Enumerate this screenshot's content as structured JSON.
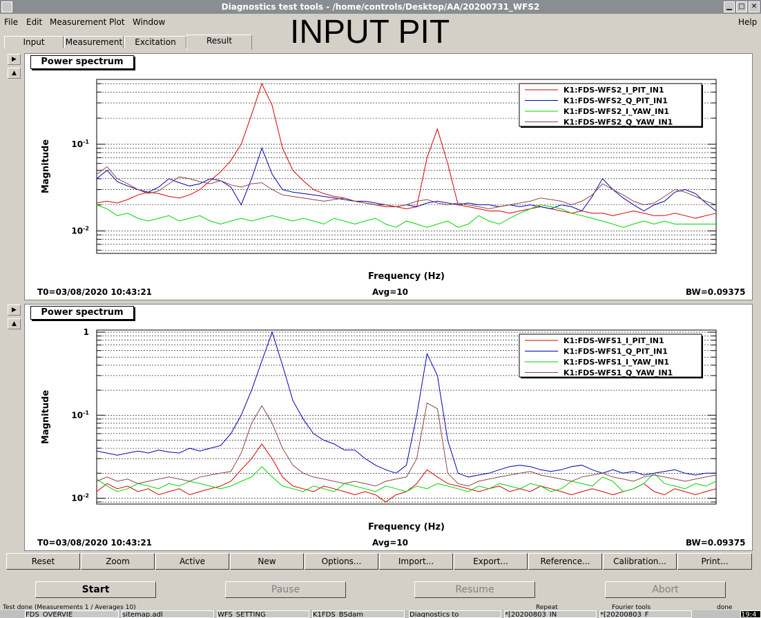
{
  "window": {
    "title": "Diagnostics test tools - /home/controls/Desktop/AA/20200731_WFS2"
  },
  "menu": [
    "File",
    "Edit",
    "Measurement",
    "Plot",
    "Window",
    "Help"
  ],
  "overlay_title": "INPUT PIT",
  "tabs": [
    "Input",
    "Measurement",
    "Excitation",
    "Result"
  ],
  "active_tab": "Result",
  "panels": [
    {
      "title": "Power spectrum",
      "ylabel": "Magnitude",
      "xlabel": "Frequency (Hz)",
      "info_t0": "T0=03/08/2020 10:43:21",
      "info_avg": "Avg=10",
      "info_bw": "BW=0.09375",
      "ytick_labels": [
        "10",
        "10"
      ],
      "ytick_exps": [
        "-1",
        "-2"
      ]
    },
    {
      "title": "Power spectrum",
      "ylabel": "Magnitude",
      "xlabel": "Frequency (Hz)",
      "info_t0": "T0=03/08/2020 10:43:21",
      "info_avg": "Avg=10",
      "info_bw": "BW=0.09375",
      "ytick_labels": [
        "1",
        "10",
        "10"
      ],
      "ytick_exps": [
        "",
        "-1",
        "-2"
      ]
    }
  ],
  "buttons": [
    "Reset",
    "Zoom",
    "Active",
    "New",
    "Options...",
    "Import...",
    "Export...",
    "Reference...",
    "Calibration...",
    "Print..."
  ],
  "controls": {
    "start": "Start",
    "pause": "Pause",
    "resume": "Resume",
    "abort": "Abort"
  },
  "status": {
    "main": "Test done (Measurements 1 / Averages 10)",
    "repeat": "Repeat",
    "fourier": "Fourier tools",
    "done": "done"
  },
  "taskbar": [
    "FDS_OVERVIE",
    "sitemap.adl",
    "WFS_SETTING",
    "K1FDS_BSdam",
    "Diagnostics to",
    "*[20200803_IN",
    "*[20200803_F",
    "19:4"
  ],
  "chart_data": [
    {
      "type": "line",
      "title": "Power spectrum",
      "xlabel": "Frequency (Hz)",
      "ylabel": "Magnitude",
      "y_scale": "log",
      "ylim": [
        0.0055,
        0.56
      ],
      "grid": true,
      "legend_position": "top-right",
      "legend": [
        "K1:FDS-WFS2_I_PIT_IN1",
        "K1:FDS-WFS2_Q_PIT_IN1",
        "K1:FDS-WFS2_I_YAW_IN1",
        "K1:FDS-WFS2_Q_YAW_IN1"
      ],
      "x": [
        0,
        1,
        2,
        3,
        4,
        5,
        6,
        7,
        8,
        9,
        10,
        11,
        12,
        13,
        14,
        15,
        16,
        17,
        18,
        19,
        20,
        21,
        22,
        23,
        24,
        25,
        26,
        27,
        28,
        29,
        30,
        31,
        32,
        33,
        34,
        35,
        36,
        37,
        38,
        39,
        40,
        41,
        42,
        43,
        44,
        45,
        46,
        47,
        48,
        49,
        50,
        51,
        52,
        53,
        54,
        55,
        56,
        57,
        58,
        59,
        60
      ],
      "series": [
        {
          "name": "K1:FDS-WFS2_I_PIT_IN1",
          "color": "#d40000",
          "values": [
            0.021,
            0.022,
            0.021,
            0.023,
            0.026,
            0.028,
            0.027,
            0.025,
            0.024,
            0.026,
            0.03,
            0.038,
            0.048,
            0.065,
            0.1,
            0.22,
            0.5,
            0.28,
            0.09,
            0.05,
            0.038,
            0.03,
            0.027,
            0.025,
            0.024,
            0.022,
            0.021,
            0.02,
            0.019,
            0.019,
            0.018,
            0.019,
            0.07,
            0.15,
            0.06,
            0.02,
            0.019,
            0.018,
            0.017,
            0.017,
            0.016,
            0.017,
            0.018,
            0.019,
            0.018,
            0.017,
            0.016,
            0.017,
            0.016,
            0.016,
            0.015,
            0.016,
            0.017,
            0.016,
            0.015,
            0.015,
            0.016,
            0.015,
            0.014,
            0.015,
            0.016
          ]
        },
        {
          "name": "K1:FDS-WFS2_Q_PIT_IN1",
          "color": "#0000b0",
          "values": [
            0.04,
            0.05,
            0.037,
            0.033,
            0.03,
            0.028,
            0.032,
            0.04,
            0.036,
            0.033,
            0.035,
            0.04,
            0.038,
            0.032,
            0.02,
            0.04,
            0.09,
            0.045,
            0.03,
            0.028,
            0.027,
            0.026,
            0.025,
            0.024,
            0.023,
            0.022,
            0.022,
            0.021,
            0.02,
            0.019,
            0.02,
            0.019,
            0.021,
            0.022,
            0.021,
            0.02,
            0.021,
            0.02,
            0.02,
            0.019,
            0.02,
            0.019,
            0.02,
            0.019,
            0.018,
            0.02,
            0.019,
            0.017,
            0.025,
            0.04,
            0.03,
            0.024,
            0.02,
            0.017,
            0.02,
            0.022,
            0.028,
            0.03,
            0.027,
            0.021,
            0.017
          ]
        },
        {
          "name": "K1:FDS-WFS2_I_YAW_IN1",
          "color": "#00d400",
          "values": [
            0.02,
            0.018,
            0.015,
            0.016,
            0.014,
            0.013,
            0.014,
            0.015,
            0.013,
            0.014,
            0.015,
            0.013,
            0.012,
            0.013,
            0.014,
            0.013,
            0.014,
            0.015,
            0.014,
            0.013,
            0.014,
            0.013,
            0.012,
            0.014,
            0.013,
            0.012,
            0.013,
            0.014,
            0.012,
            0.011,
            0.013,
            0.012,
            0.011,
            0.012,
            0.013,
            0.011,
            0.012,
            0.015,
            0.013,
            0.012,
            0.014,
            0.016,
            0.018,
            0.02,
            0.019,
            0.018,
            0.016,
            0.015,
            0.014,
            0.013,
            0.012,
            0.011,
            0.012,
            0.013,
            0.012,
            0.013,
            0.012,
            0.012,
            0.012,
            0.012,
            0.012
          ]
        },
        {
          "name": "K1:FDS-WFS2_Q_YAW_IN1",
          "color": "#8b4545",
          "values": [
            0.045,
            0.055,
            0.04,
            0.035,
            0.03,
            0.027,
            0.029,
            0.035,
            0.042,
            0.04,
            0.037,
            0.035,
            0.038,
            0.034,
            0.032,
            0.035,
            0.036,
            0.03,
            0.026,
            0.025,
            0.024,
            0.023,
            0.022,
            0.023,
            0.024,
            0.022,
            0.021,
            0.02,
            0.02,
            0.019,
            0.02,
            0.022,
            0.023,
            0.021,
            0.02,
            0.021,
            0.02,
            0.019,
            0.018,
            0.019,
            0.02,
            0.021,
            0.022,
            0.024,
            0.023,
            0.022,
            0.02,
            0.022,
            0.026,
            0.035,
            0.03,
            0.026,
            0.022,
            0.02,
            0.021,
            0.025,
            0.03,
            0.028,
            0.025,
            0.022,
            0.02
          ]
        }
      ]
    },
    {
      "type": "line",
      "title": "Power spectrum",
      "xlabel": "Frequency (Hz)",
      "ylabel": "Magnitude",
      "y_scale": "log",
      "ylim": [
        0.0085,
        1.06
      ],
      "grid": true,
      "legend_position": "top-right",
      "legend": [
        "K1:FDS-WFS1_I_PIT_IN1",
        "K1:FDS-WFS1_Q_PIT_IN1",
        "K1:FDS-WFS1_I_YAW_IN1",
        "K1:FDS-WFS1_Q_YAW_IN1"
      ],
      "x": [
        0,
        1,
        2,
        3,
        4,
        5,
        6,
        7,
        8,
        9,
        10,
        11,
        12,
        13,
        14,
        15,
        16,
        17,
        18,
        19,
        20,
        21,
        22,
        23,
        24,
        25,
        26,
        27,
        28,
        29,
        30,
        31,
        32,
        33,
        34,
        35,
        36,
        37,
        38,
        39,
        40,
        41,
        42,
        43,
        44,
        45,
        46,
        47,
        48,
        49,
        50,
        51,
        52,
        53,
        54,
        55,
        56,
        57,
        58,
        59,
        60
      ],
      "series": [
        {
          "name": "K1:FDS-WFS1_I_PIT_IN1",
          "color": "#d40000",
          "values": [
            0.012,
            0.015,
            0.013,
            0.014,
            0.012,
            0.013,
            0.011,
            0.012,
            0.013,
            0.011,
            0.012,
            0.013,
            0.014,
            0.016,
            0.022,
            0.03,
            0.045,
            0.03,
            0.018,
            0.014,
            0.013,
            0.012,
            0.014,
            0.013,
            0.012,
            0.011,
            0.012,
            0.011,
            0.009,
            0.011,
            0.012,
            0.015,
            0.022,
            0.018,
            0.015,
            0.014,
            0.013,
            0.012,
            0.013,
            0.014,
            0.012,
            0.013,
            0.012,
            0.014,
            0.013,
            0.012,
            0.011,
            0.012,
            0.013,
            0.012,
            0.011,
            0.012,
            0.013,
            0.015,
            0.012,
            0.011,
            0.013,
            0.012,
            0.011,
            0.012,
            0.013
          ]
        },
        {
          "name": "K1:FDS-WFS1_Q_PIT_IN1",
          "color": "#0000b0",
          "values": [
            0.037,
            0.035,
            0.033,
            0.035,
            0.037,
            0.035,
            0.038,
            0.036,
            0.035,
            0.04,
            0.037,
            0.04,
            0.043,
            0.06,
            0.1,
            0.2,
            0.45,
            1.0,
            0.4,
            0.15,
            0.09,
            0.06,
            0.05,
            0.045,
            0.038,
            0.038,
            0.03,
            0.025,
            0.022,
            0.02,
            0.025,
            0.1,
            0.55,
            0.3,
            0.05,
            0.02,
            0.018,
            0.019,
            0.02,
            0.022,
            0.024,
            0.025,
            0.024,
            0.022,
            0.021,
            0.022,
            0.024,
            0.025,
            0.022,
            0.02,
            0.022,
            0.02,
            0.021,
            0.019,
            0.02,
            0.021,
            0.022,
            0.02,
            0.019,
            0.02,
            0.02
          ]
        },
        {
          "name": "K1:FDS-WFS1_I_YAW_IN1",
          "color": "#00d400",
          "values": [
            0.017,
            0.014,
            0.012,
            0.013,
            0.015,
            0.014,
            0.013,
            0.015,
            0.014,
            0.016,
            0.015,
            0.014,
            0.013,
            0.014,
            0.016,
            0.018,
            0.024,
            0.018,
            0.014,
            0.013,
            0.012,
            0.014,
            0.013,
            0.012,
            0.015,
            0.014,
            0.013,
            0.012,
            0.014,
            0.013,
            0.012,
            0.014,
            0.013,
            0.015,
            0.014,
            0.013,
            0.012,
            0.014,
            0.013,
            0.015,
            0.014,
            0.013,
            0.015,
            0.014,
            0.012,
            0.013,
            0.016,
            0.015,
            0.014,
            0.018,
            0.016,
            0.012,
            0.013,
            0.015,
            0.02,
            0.015,
            0.014,
            0.013,
            0.015,
            0.014,
            0.016
          ]
        },
        {
          "name": "K1:FDS-WFS1_Q_YAW_IN1",
          "color": "#8b4545",
          "values": [
            0.016,
            0.018,
            0.016,
            0.017,
            0.015,
            0.016,
            0.017,
            0.018,
            0.017,
            0.016,
            0.018,
            0.019,
            0.02,
            0.021,
            0.035,
            0.08,
            0.13,
            0.08,
            0.04,
            0.025,
            0.02,
            0.018,
            0.017,
            0.016,
            0.015,
            0.016,
            0.015,
            0.014,
            0.016,
            0.017,
            0.018,
            0.03,
            0.14,
            0.12,
            0.02,
            0.015,
            0.014,
            0.016,
            0.017,
            0.018,
            0.019,
            0.02,
            0.021,
            0.019,
            0.018,
            0.017,
            0.016,
            0.018,
            0.019,
            0.02,
            0.018,
            0.017,
            0.016,
            0.018,
            0.019,
            0.018,
            0.017,
            0.016,
            0.017,
            0.018,
            0.019
          ]
        }
      ]
    }
  ]
}
